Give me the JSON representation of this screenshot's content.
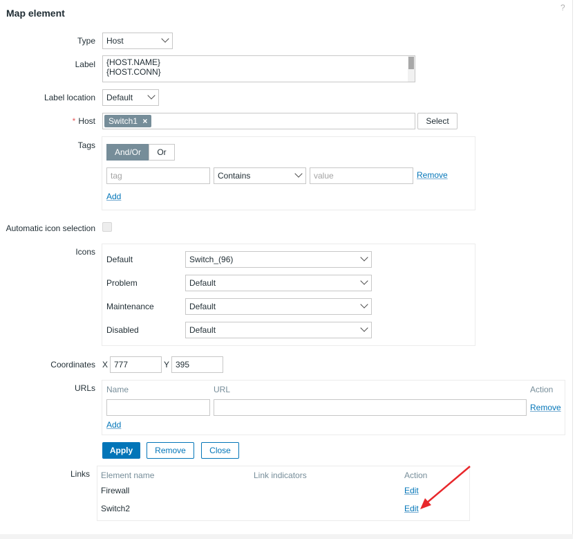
{
  "dialog": {
    "title": "Map element",
    "help": "?"
  },
  "labels": {
    "type": "Type",
    "label": "Label",
    "label_location": "Label location",
    "host": "Host",
    "tags": "Tags",
    "auto_icon": "Automatic icon selection",
    "icons": "Icons",
    "coordinates": "Coordinates",
    "urls": "URLs",
    "links": "Links"
  },
  "type_select": {
    "value": "Host"
  },
  "label_text": {
    "line1": "{HOST.NAME}",
    "line2": "{HOST.CONN}"
  },
  "label_location_select": {
    "value": "Default"
  },
  "host": {
    "required_marker": "*",
    "chip": "Switch1",
    "chip_remove": "×",
    "select_button": "Select"
  },
  "tags": {
    "and_or": "And/Or",
    "or": "Or",
    "tag_placeholder": "tag",
    "operator": "Contains",
    "value_placeholder": "value",
    "remove": "Remove",
    "add": "Add"
  },
  "icons": {
    "rows": [
      {
        "label": "Default",
        "value": "Switch_(96)"
      },
      {
        "label": "Problem",
        "value": "Default"
      },
      {
        "label": "Maintenance",
        "value": "Default"
      },
      {
        "label": "Disabled",
        "value": "Default"
      }
    ]
  },
  "coordinates": {
    "x_label": "X",
    "x_value": "777",
    "y_label": "Y",
    "y_value": "395"
  },
  "urls": {
    "col_name": "Name",
    "col_url": "URL",
    "col_action": "Action",
    "remove": "Remove",
    "add": "Add"
  },
  "actions": {
    "apply": "Apply",
    "remove": "Remove",
    "close": "Close"
  },
  "links": {
    "col_element": "Element name",
    "col_indicators": "Link indicators",
    "col_action": "Action",
    "rows": [
      {
        "element": "Firewall",
        "action": "Edit"
      },
      {
        "element": "Switch2",
        "action": "Edit"
      }
    ]
  },
  "colors": {
    "accent": "#0275b8",
    "arrow": "#e8272b",
    "chip": "#768d99"
  }
}
